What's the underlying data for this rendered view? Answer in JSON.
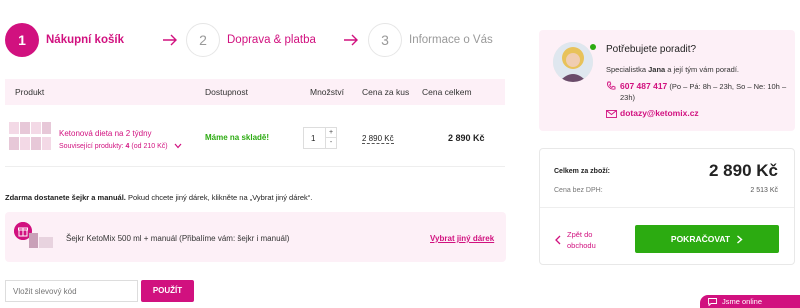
{
  "steps": [
    {
      "number": "1",
      "label": "Nákupní košík"
    },
    {
      "number": "2",
      "label": "Doprava & platba"
    },
    {
      "number": "3",
      "label": "Informace o Vás"
    }
  ],
  "table": {
    "headers": {
      "product": "Produkt",
      "availability": "Dostupnost",
      "quantity": "Množství",
      "unit_price": "Cena za kus",
      "total": "Cena celkem"
    },
    "rows": [
      {
        "name": "Ketonová dieta na 2 týdny",
        "related_prefix": "Související produkty:",
        "related_count": "4",
        "related_price": "(od 210 Kč)",
        "availability": "Máme na skladě!",
        "quantity": "1",
        "unit_price": "2 890 Kč",
        "total": "2 890 Kč"
      }
    ]
  },
  "gift": {
    "note_bold": "Zdarma dostanete šejkr a manuál.",
    "note_rest": " Pokud chcete jiný dárek, klikněte na „Vybrat jiný dárek“.",
    "item_text": "Šejkr KetoMix 500 ml + manuál (Přibalíme vám: šejkr i manuál)",
    "change_link": "Vybrat jiný dárek"
  },
  "coupon": {
    "placeholder": "Vložit slevový kód",
    "button": "POUŽÍT"
  },
  "advisor": {
    "title": "Potřebujete poradit?",
    "sub_prefix": "Specialistka ",
    "name": "Jana",
    "sub_suffix": " a její tým vám poradí.",
    "phone": "607 487 417",
    "hours": " (Po – Pá: 8h – 23h, So – Ne: 10h – 23h)",
    "email": "dotazy@ketomix.cz"
  },
  "summary": {
    "total_label": "Celkem za zboží:",
    "total_value": "2 890 Kč",
    "vat_label": "Cena bez DPH:",
    "vat_value": "2 513 Kč",
    "back_label": "Zpět do obchodu",
    "continue_label": "POKRAČOVAT"
  },
  "chat": {
    "label": "Jsme online"
  },
  "colors": {
    "accent": "#d1117f",
    "success": "#2cab11",
    "panel_bg": "#fdf0f7"
  }
}
